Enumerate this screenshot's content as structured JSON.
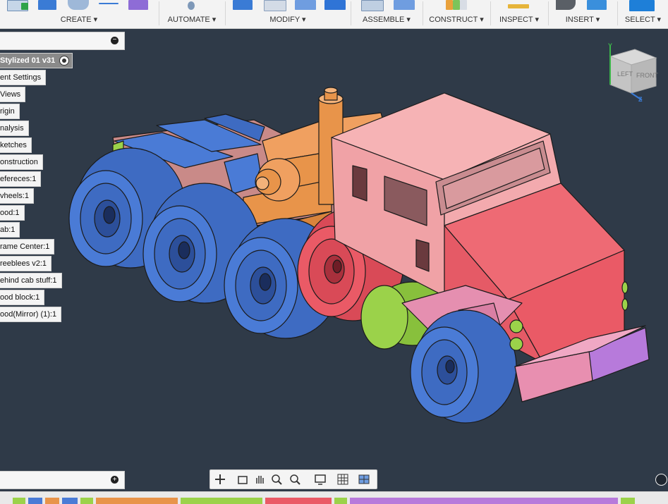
{
  "toolbar": {
    "groups": [
      {
        "label": "CREATE ▾"
      },
      {
        "label": "AUTOMATE ▾"
      },
      {
        "label": "MODIFY ▾"
      },
      {
        "label": "ASSEMBLE ▾"
      },
      {
        "label": "CONSTRUCT ▾"
      },
      {
        "label": "INSPECT ▾"
      },
      {
        "label": "INSERT ▾"
      },
      {
        "label": "SELECT ▾"
      }
    ]
  },
  "browser": {
    "root_label": "Stylized 01 v31",
    "nodes": [
      {
        "label": "ent Settings"
      },
      {
        "label": "Views"
      },
      {
        "label": "rigin"
      },
      {
        "label": "nalysis"
      },
      {
        "label": "ketches"
      },
      {
        "label": "onstruction"
      },
      {
        "label": "efereces:1"
      },
      {
        "label": "vheels:1"
      },
      {
        "label": "ood:1"
      },
      {
        "label": "ab:1"
      },
      {
        "label": "rame Center:1"
      },
      {
        "label": "reeblees v2:1"
      },
      {
        "label": "ehind cab stuff:1"
      },
      {
        "label": "ood block:1"
      },
      {
        "label": "ood(Mirror) (1):1"
      }
    ],
    "collapse_icon": "minus-circle-icon"
  },
  "comments": {
    "add_icon": "plus-circle-icon"
  },
  "viewcube": {
    "face_left": "LEFT",
    "face_front": "FRONT",
    "axis_y": "Y",
    "axis_z": "Z"
  },
  "navbar": {
    "icons": [
      "orbit-icon",
      "look-at-icon",
      "pan-icon",
      "zoom-icon",
      "fit-icon",
      "display-settings-icon",
      "grid-icon",
      "viewports-icon"
    ]
  },
  "colors": {
    "background": "#2f3a48",
    "wheel_blue": "#4a7bd6",
    "cab_pink": "#f0a2a6",
    "hood_red": "#ea5a66",
    "engine_orange": "#e8944a",
    "tank_green": "#9bd24a",
    "bumper_purple": "#b77adb"
  }
}
